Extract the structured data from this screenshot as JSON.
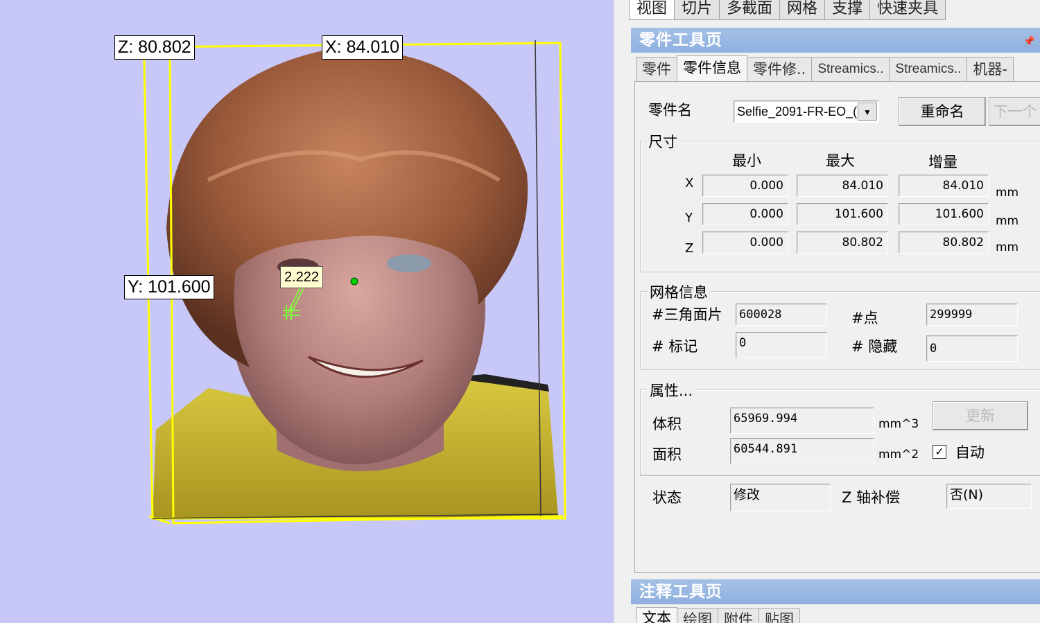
{
  "viewport": {
    "dims": {
      "z_label": "Z: 80.802",
      "x_label": "X: 84.010",
      "y_label": "Y: 101.600"
    },
    "measure_label": "2.222",
    "colors": {
      "background": "#c8c8f8",
      "bounding_box": "#ffff00"
    }
  },
  "tabs_top": [
    "视图",
    "切片",
    "多截面",
    "网格",
    "支撑",
    "快速夹具"
  ],
  "part_toolbar": {
    "title": "零件工具页",
    "tabs": [
      "零件",
      "零件信息",
      "零件修..",
      "Streamics..",
      "Streamics..",
      "机器-"
    ],
    "active_tab": "零件信息",
    "part_name_label": "零件名",
    "part_name_value": "Selfie_2091-FR-EO_(",
    "rename_button": "重命名",
    "next_button": "下一个",
    "dimensions": {
      "title": "尺寸",
      "col_min": "最小",
      "col_max": "最大",
      "col_delta": "增量",
      "rows": [
        {
          "axis": "X",
          "min": "0.000",
          "max": "84.010",
          "delta": "84.010",
          "unit": "mm"
        },
        {
          "axis": "Y",
          "min": "0.000",
          "max": "101.600",
          "delta": "101.600",
          "unit": "mm"
        },
        {
          "axis": "Z",
          "min": "0.000",
          "max": "80.802",
          "delta": "80.802",
          "unit": "mm"
        }
      ]
    },
    "mesh": {
      "title": "网格信息",
      "triangles_label": "#三角面片",
      "triangles_value": "600028",
      "points_label": "#点",
      "points_value": "299999",
      "marked_label": "# 标记",
      "marked_value": "0",
      "hidden_label": "# 隐藏",
      "hidden_value": "0"
    },
    "properties": {
      "title": "属性...",
      "volume_label": "体积",
      "volume_value": "65969.994",
      "volume_unit": "mm^3",
      "area_label": "面积",
      "area_value": "60544.891",
      "area_unit": "mm^2",
      "update_button": "更新",
      "auto_label": "自动",
      "auto_checked": true
    },
    "status": {
      "status_label": "状态",
      "status_value": "修改",
      "z_comp_label": "Z 轴补偿",
      "z_comp_value": "否(N)"
    }
  },
  "annotation_toolbar": {
    "title": "注释工具页",
    "tabs": [
      "文本",
      "绘图",
      "附件",
      "贴图"
    ]
  }
}
